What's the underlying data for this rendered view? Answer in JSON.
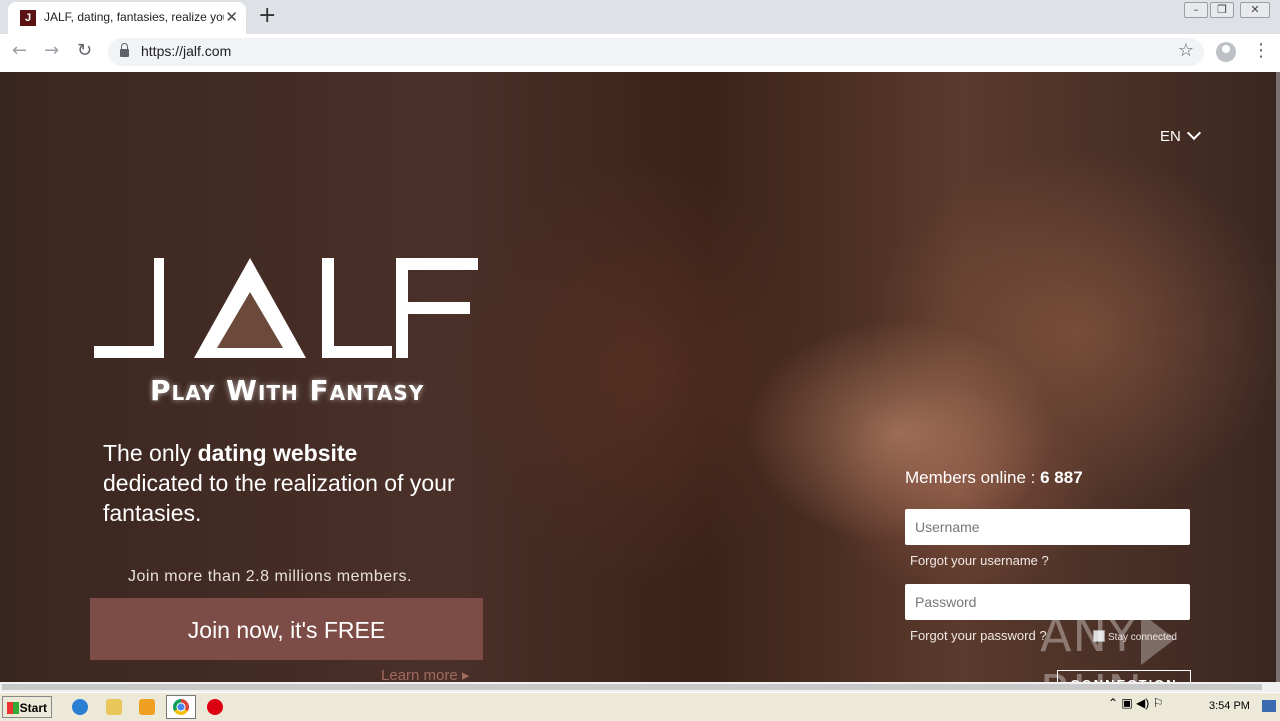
{
  "browser": {
    "tab_title": "JALF, dating, fantasies, realize your",
    "tab_favicon": "J",
    "url": "https://jalf.com"
  },
  "page": {
    "language": "EN",
    "logo_text": "JALF",
    "tagline": "Play With Fantasy",
    "headline_pre": "The only ",
    "headline_bold": "dating website",
    "headline_post": "dedicated to the realization of your fantasies.",
    "join_more": "Join more than 2.8 millions members.",
    "join_button": "Join now, it's FREE",
    "learn_more": "Learn more ▸",
    "members_label": "Members online : ",
    "members_count": "6 887",
    "username_placeholder": "Username",
    "forgot_username": "Forgot your username ?",
    "password_placeholder": "Password",
    "forgot_password": "Forgot your password ?",
    "stay_connected": "Stay connected",
    "connection_button": "CONNECTION",
    "watermark_left": "ANY",
    "watermark_right": "RUN"
  },
  "taskbar": {
    "start_label": "Start",
    "clock": "3:54 PM"
  }
}
